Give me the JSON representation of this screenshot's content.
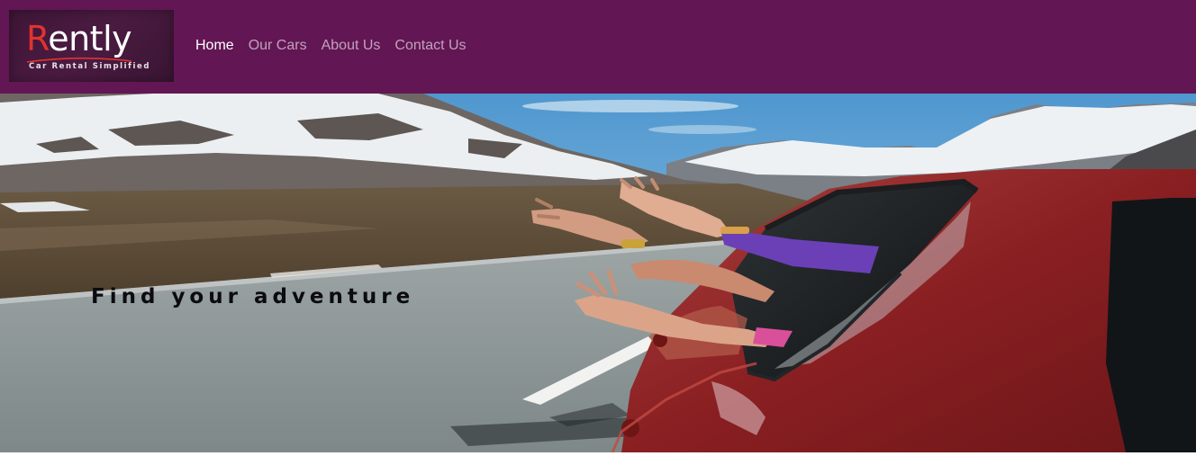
{
  "brand": {
    "logo_first_letter": "R",
    "logo_rest": "ently",
    "tagline": "Car Rental Simplified",
    "colors": {
      "navbar": "#621654",
      "logo_accent": "#e0332f"
    }
  },
  "nav": {
    "items": [
      {
        "label": "Home",
        "active": true
      },
      {
        "label": "Our Cars",
        "active": false
      },
      {
        "label": "About Us",
        "active": false
      },
      {
        "label": "Contact Us",
        "active": false
      }
    ]
  },
  "hero": {
    "caption": "Find your adventure",
    "image_subject": "red car on mountain road with waving hands out of window"
  }
}
